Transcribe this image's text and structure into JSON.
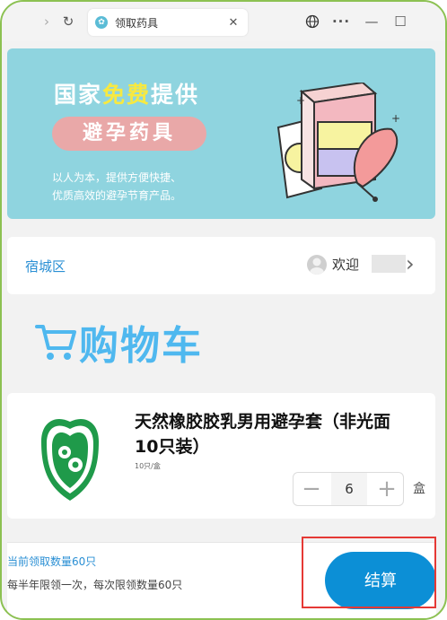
{
  "browser": {
    "tab_title": "领取药具",
    "close_glyph": "✕",
    "back_glyph": "›",
    "reload_glyph": "↻",
    "more_glyph": "···",
    "min_glyph": "—",
    "max_glyph": "☐"
  },
  "banner": {
    "title_prefix": "国家",
    "title_highlight": "免费",
    "title_suffix": "提供",
    "pill": "避孕药具",
    "desc_line1": "以人为本，提供方便快捷、",
    "desc_line2": "优质高效的避孕节育产品。"
  },
  "location": {
    "district": "宿城区",
    "welcome": "欢迎"
  },
  "cart": {
    "title": "购物车"
  },
  "product": {
    "name": "天然橡胶胶乳男用避孕套（非光面10只装）",
    "unit_spec": "10只/盒",
    "quantity": "6",
    "unit": "盒",
    "minus": "−",
    "plus": "+"
  },
  "footer": {
    "quota": "当前领取数量60只",
    "rule": "每半年限领一次，每次限领数量60只",
    "checkout": "结算"
  },
  "colors": {
    "accent": "#0c8fd6",
    "banner_bg": "#8fd4df",
    "cart_title": "#4fb8ef",
    "highlight": "#e53935",
    "frame": "#8cc152"
  }
}
